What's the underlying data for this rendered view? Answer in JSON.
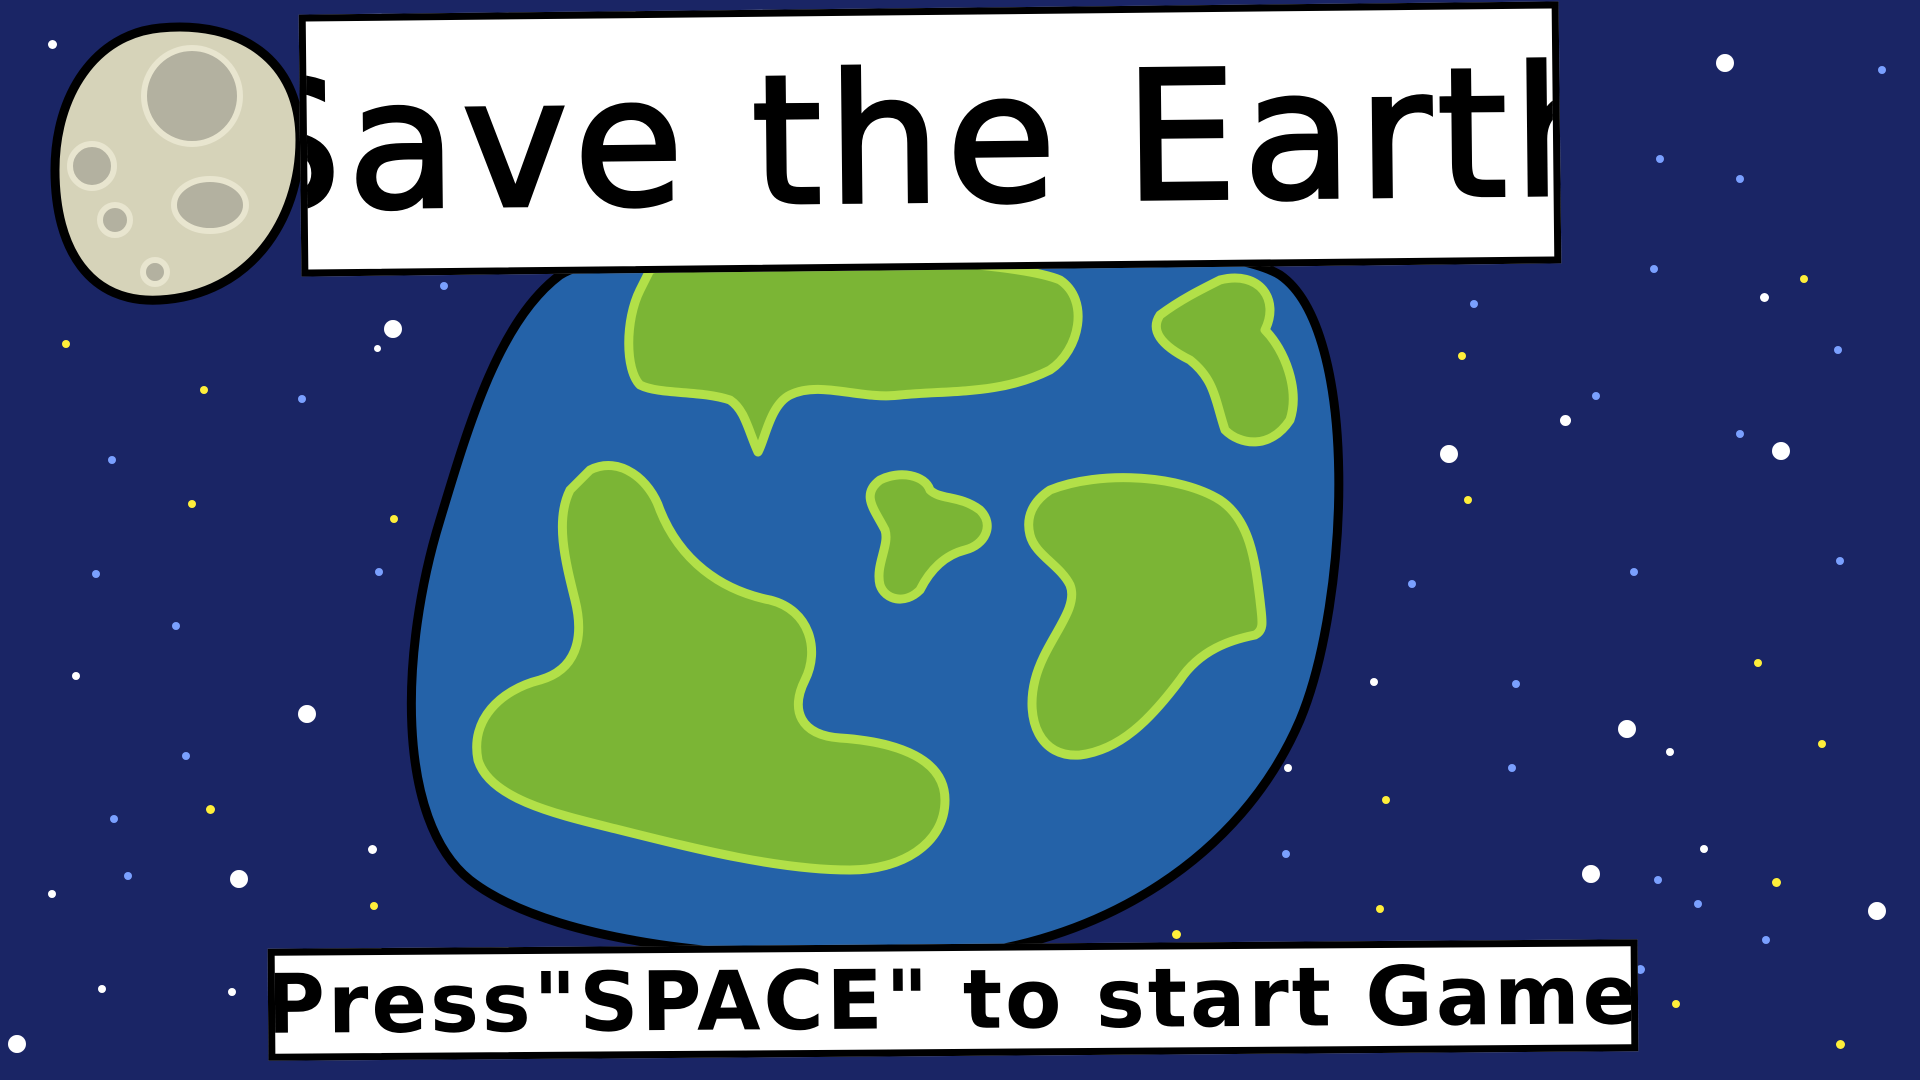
{
  "screen": {
    "title": "Save the Earth",
    "start_prompt": "Press\"SPACE\" to start Game"
  },
  "colors": {
    "space": "#1a2565",
    "ocean": "#2462a8",
    "land": "#7bb535",
    "land_outline": "#b2e048",
    "moon": "#d6d3b9",
    "moon_crater": "#b3b1a0",
    "banner_bg": "#ffffff",
    "outline": "#000000",
    "star_white": "#ffffff",
    "star_yellow": "#ffef3a",
    "star_blue": "#7aa0ff"
  },
  "icons": {
    "planet": "earth-icon",
    "satellite": "moon-icon",
    "background": "star-icon"
  }
}
